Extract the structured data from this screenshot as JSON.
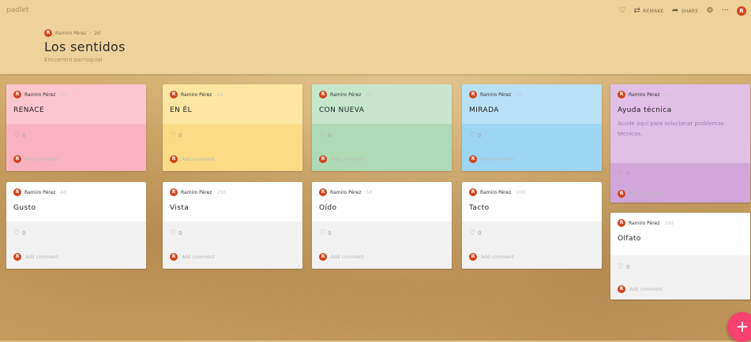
{
  "app": {
    "brand": "padlet"
  },
  "toolbar": {
    "remake_label": "REMAKE",
    "share_label": "SHARE",
    "more_label": "···",
    "user_initial": "R"
  },
  "board": {
    "author": "Ramiro Pérez",
    "age": "2d",
    "title": "Los sentidos",
    "subtitle": "Encuentro parroquial"
  },
  "cards": [
    {
      "author": "Ramiro Pérez",
      "time": "5d",
      "title": "RENACE",
      "likes": "0",
      "comment_placeholder": "Add comment"
    },
    {
      "author": "Ramiro Pérez",
      "time": "5d",
      "title": "EN ÉL",
      "likes": "0",
      "comment_placeholder": "Add comment"
    },
    {
      "author": "Ramiro Pérez",
      "time": "5d",
      "title": "CON NUEVA",
      "likes": "0",
      "comment_placeholder": "Add comment"
    },
    {
      "author": "Ramiro Pérez",
      "time": "5d",
      "title": "MIRADA",
      "likes": "0",
      "comment_placeholder": "Add comment"
    },
    {
      "author": "Ramiro Pérez",
      "time": "2d",
      "title": "Ayuda técnica",
      "body": "Acude aquí para solucionar problemas técnicos.",
      "likes": "0",
      "comment_placeholder": "Add comment"
    },
    {
      "author": "Ramiro Pérez",
      "time": "4d",
      "title": "Gusto",
      "likes": "0",
      "comment_placeholder": "Add comment"
    },
    {
      "author": "Ramiro Pérez",
      "time": "20d",
      "title": "Vista",
      "likes": "0",
      "comment_placeholder": "Add comment"
    },
    {
      "author": "Ramiro Pérez",
      "time": "5d",
      "title": "Oído",
      "likes": "0",
      "comment_placeholder": "Add comment"
    },
    {
      "author": "Ramiro Pérez",
      "time": "20d",
      "title": "Tacto",
      "likes": "0",
      "comment_placeholder": "Add comment"
    },
    {
      "author": "Ramiro Pérez",
      "time": "20d",
      "title": "Olfato",
      "likes": "0",
      "comment_placeholder": "Add comment"
    }
  ],
  "colors": {
    "pink": "#fcc6cf",
    "pink_dark": "#f9b3c0",
    "yellow": "#fde6a3",
    "yellow_dark": "#fbdc84",
    "green": "#c6e7cc",
    "green_dark": "#aedbb6",
    "blue": "#b8e1f6",
    "blue_dark": "#9dd6f3",
    "purple": "#e1bfe6",
    "purple_dark": "#d2a6da",
    "white": "#ffffff",
    "white_dark": "#f2f2f2",
    "avatar": "#d0451c",
    "fab": "#f5426e"
  },
  "fab": {
    "label": "+"
  }
}
